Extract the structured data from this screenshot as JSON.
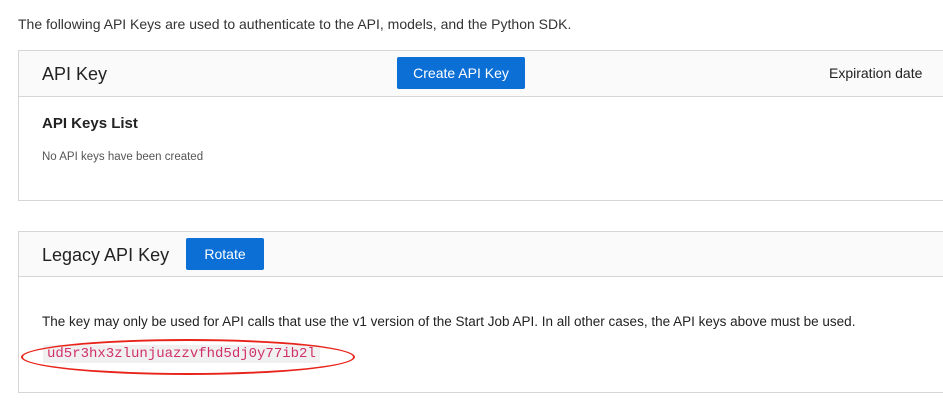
{
  "intro": "The following API Keys are used to authenticate to the API, models, and the Python SDK.",
  "api_key_section": {
    "title": "API Key",
    "create_button": "Create API Key",
    "expiration_header": "Expiration date",
    "list_title": "API Keys List",
    "empty_message": "No API keys have been created"
  },
  "legacy_section": {
    "title": "Legacy API Key",
    "rotate_button": "Rotate",
    "description": "The key may only be used for API calls that use the v1 version of the Start Job API. In all other cases, the API keys above must be used.",
    "key_value": "ud5r3hx3zlunjuazzvfhd5dj0y77ib2l"
  },
  "colors": {
    "accent": "#0b6fd6",
    "key_text": "#d0306a",
    "highlight": "#e8231a"
  }
}
